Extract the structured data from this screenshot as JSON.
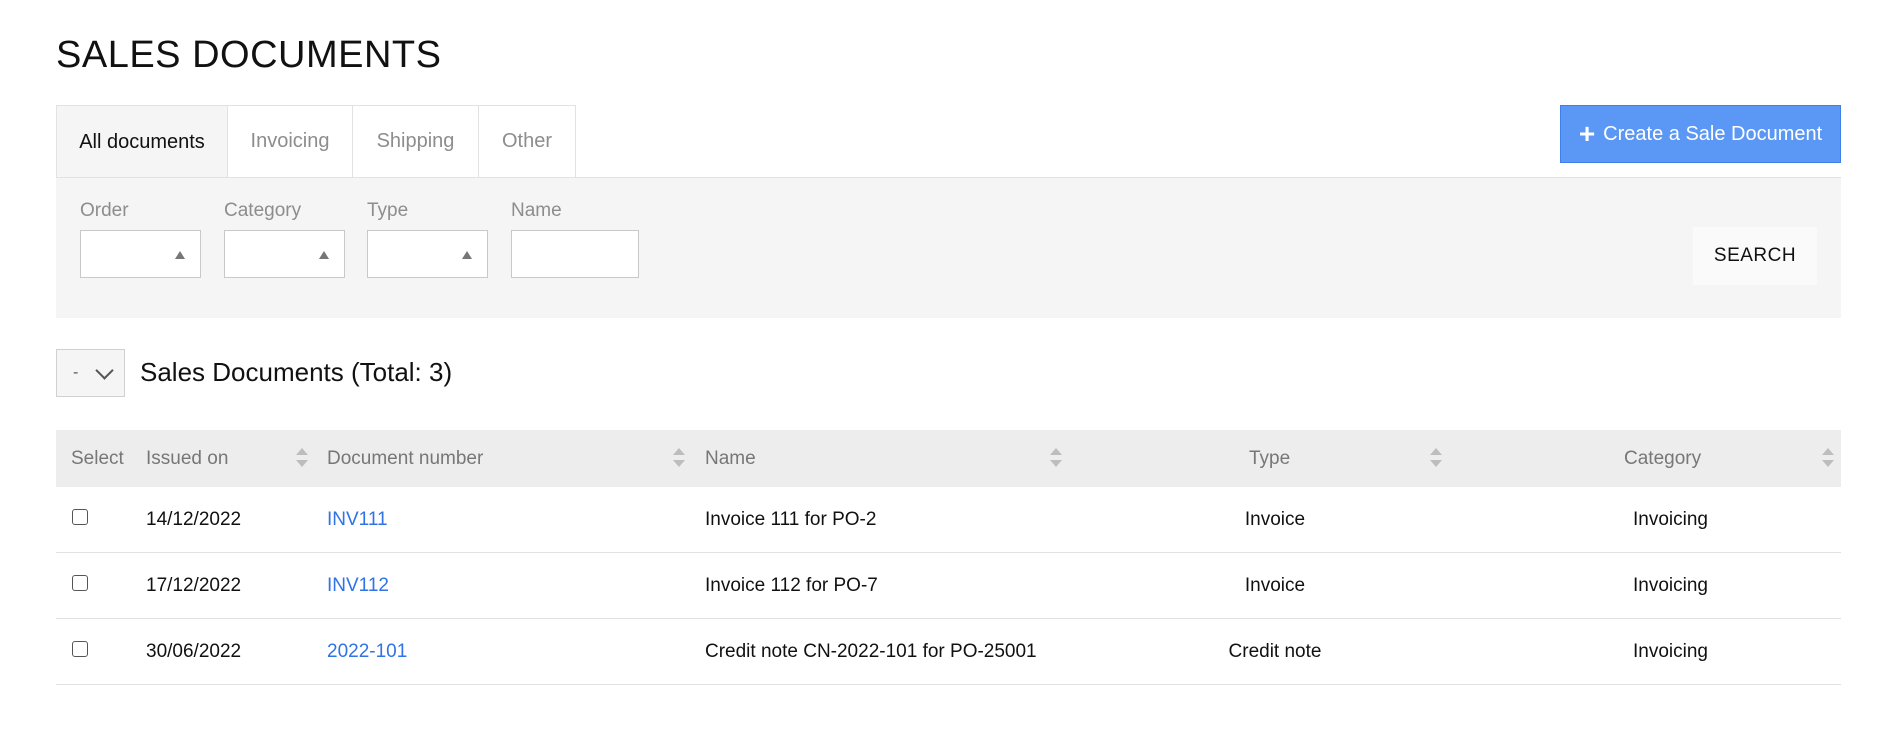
{
  "page_title": "SALES DOCUMENTS",
  "tabs": [
    {
      "label": "All documents",
      "active": true
    },
    {
      "label": "Invoicing",
      "active": false
    },
    {
      "label": "Shipping",
      "active": false
    },
    {
      "label": "Other",
      "active": false
    }
  ],
  "create_button": {
    "icon": "plus-icon",
    "label": "Create a Sale Document"
  },
  "filters": {
    "order_label": "Order",
    "category_label": "Category",
    "type_label": "Type",
    "name_label": "Name",
    "name_value": "",
    "search_label": "SEARCH"
  },
  "bulk_select": {
    "value": "-"
  },
  "list_title": "Sales Documents (Total: 3)",
  "table": {
    "headers": {
      "select": "Select",
      "issued_on": "Issued on",
      "document_number": "Document number",
      "name": "Name",
      "type": "Type",
      "category": "Category"
    },
    "rows": [
      {
        "issued_on": "14/12/2022",
        "document_number": "INV111",
        "name": "Invoice 111 for PO-2",
        "type": "Invoice",
        "category": "Invoicing"
      },
      {
        "issued_on": "17/12/2022",
        "document_number": "INV112",
        "name": "Invoice 112 for PO-7",
        "type": "Invoice",
        "category": "Invoicing"
      },
      {
        "issued_on": "30/06/2022",
        "document_number": "2022-101",
        "name": "Credit note CN-2022-101 for PO-25001",
        "type": "Credit note",
        "category": "Invoicing"
      }
    ]
  },
  "colors": {
    "primary": "#5b97f5",
    "link": "#2f73e6",
    "panel": "#f5f5f5"
  }
}
